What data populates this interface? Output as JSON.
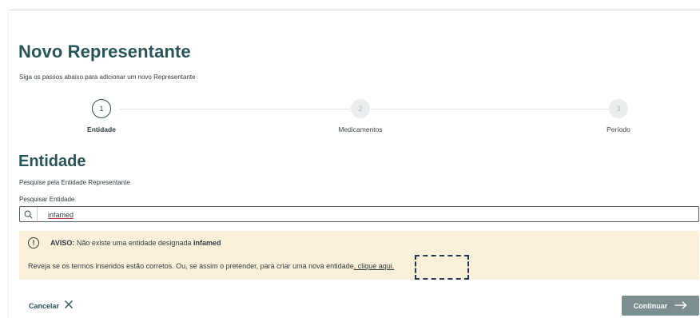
{
  "header": {
    "title": "Novo Representante",
    "subtitle": "Siga os passos abaixo para adicionar um novo Representante"
  },
  "stepper": {
    "steps": [
      {
        "number": "1",
        "label": "Entidade",
        "active": true
      },
      {
        "number": "2",
        "label": "Medicamentos",
        "active": false
      },
      {
        "number": "3",
        "label": "Período",
        "active": false
      }
    ]
  },
  "section": {
    "title": "Entidade",
    "subtitle": "Pesquise pela Entidade Representante",
    "search_label": "Pesquisar Entidade",
    "search_value": "infamed"
  },
  "warning": {
    "icon": "!",
    "prefix": "AVISO:",
    "message": "Não existe uma entidade designada",
    "entity": "infamed",
    "detail": "Reveja se os termos inseridos estão corretos. Ou, se assim o pretender, para criar uma nova entidade",
    "link": ", clique aqui."
  },
  "footer": {
    "cancel_label": "Cancelar",
    "continue_label": "Continuar"
  },
  "colors": {
    "accent": "#2a5558",
    "warning_bg": "#fbf1da",
    "button_bg": "#7b8e8f"
  }
}
